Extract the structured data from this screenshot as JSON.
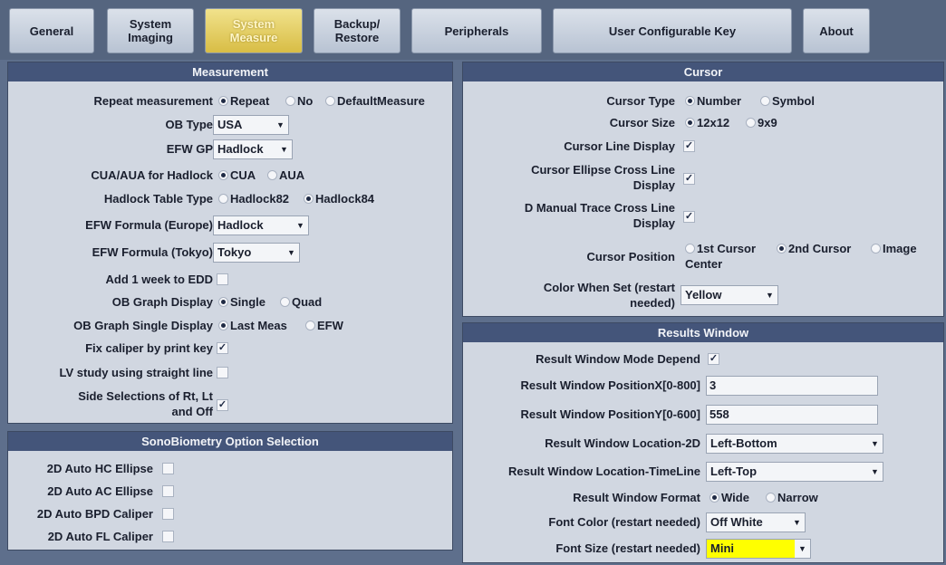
{
  "tabs": [
    {
      "label": "General"
    },
    {
      "label": "System\nImaging"
    },
    {
      "label": "System\nMeasure"
    },
    {
      "label": "Backup/\nRestore"
    },
    {
      "label": "Peripherals"
    },
    {
      "label": "User Configurable Key"
    },
    {
      "label": "About"
    }
  ],
  "measurement": {
    "title": "Measurement",
    "repeat_label": "Repeat measurement",
    "repeat_options": [
      "Repeat",
      "No",
      "DefaultMeasure"
    ],
    "ob_type_label": "OB Type",
    "ob_type_value": "USA",
    "efw_gp_label": "EFW GP",
    "efw_gp_value": "Hadlock",
    "cua_label": "CUA/AUA for Hadlock",
    "cua_options": [
      "CUA",
      "AUA"
    ],
    "hadlock_label": "Hadlock Table Type",
    "hadlock_options": [
      "Hadlock82",
      "Hadlock84"
    ],
    "efw_europe_label": "EFW Formula (Europe)",
    "efw_europe_value": "Hadlock",
    "efw_tokyo_label": "EFW Formula (Tokyo)",
    "efw_tokyo_value": "Tokyo",
    "add_week_label": "Add 1 week to EDD",
    "ob_graph_label": "OB Graph Display",
    "ob_graph_options": [
      "Single",
      "Quad"
    ],
    "ob_single_label": "OB Graph Single Display",
    "ob_single_options": [
      "Last Meas",
      "EFW"
    ],
    "fix_caliper_label": "Fix caliper by print key",
    "lv_study_label": "LV study using straight line",
    "side_sel_label": "Side Selections of Rt, Lt\nand Off"
  },
  "sono": {
    "title": "SonoBiometry Option Selection",
    "items": [
      "2D Auto HC Ellipse",
      "2D Auto AC Ellipse",
      "2D Auto BPD Caliper",
      "2D Auto FL Caliper"
    ]
  },
  "cursor": {
    "title": "Cursor",
    "type_label": "Cursor Type",
    "type_options": [
      "Number",
      "Symbol"
    ],
    "size_label": "Cursor Size",
    "size_options": [
      "12x12",
      "9x9"
    ],
    "line_label": "Cursor Line Display",
    "ellipse_label": "Cursor Ellipse Cross Line\nDisplay",
    "dmanual_label": "D Manual Trace Cross Line\nDisplay",
    "position_label": "Cursor Position",
    "position_options": [
      "1st Cursor",
      "2nd Cursor",
      "Image"
    ],
    "position_wrap": "Center",
    "color_label": "Color When Set (restart\nneeded)",
    "color_value": "Yellow"
  },
  "results": {
    "title": "Results Window",
    "mode_label": "Result Window Mode Depend",
    "posx_label": "Result Window PositionX[0-800]",
    "posx_value": "3",
    "posy_label": "Result Window PositionY[0-600]",
    "posy_value": "558",
    "loc2d_label": "Result Window Location-2D",
    "loc2d_value": "Left-Bottom",
    "loctl_label": "Result Window Location-TimeLine",
    "loctl_value": "Left-Top",
    "format_label": "Result Window Format",
    "format_options": [
      "Wide",
      "Narrow"
    ],
    "fontcolor_label": "Font Color (restart needed)",
    "fontcolor_value": "Off White",
    "fontsize_label": "Font Size (restart needed)",
    "fontsize_value": "Mini"
  },
  "colors": {
    "highlight": "#ffff00",
    "panel_title": "#44557a",
    "active_tab": "#e3c95a"
  }
}
